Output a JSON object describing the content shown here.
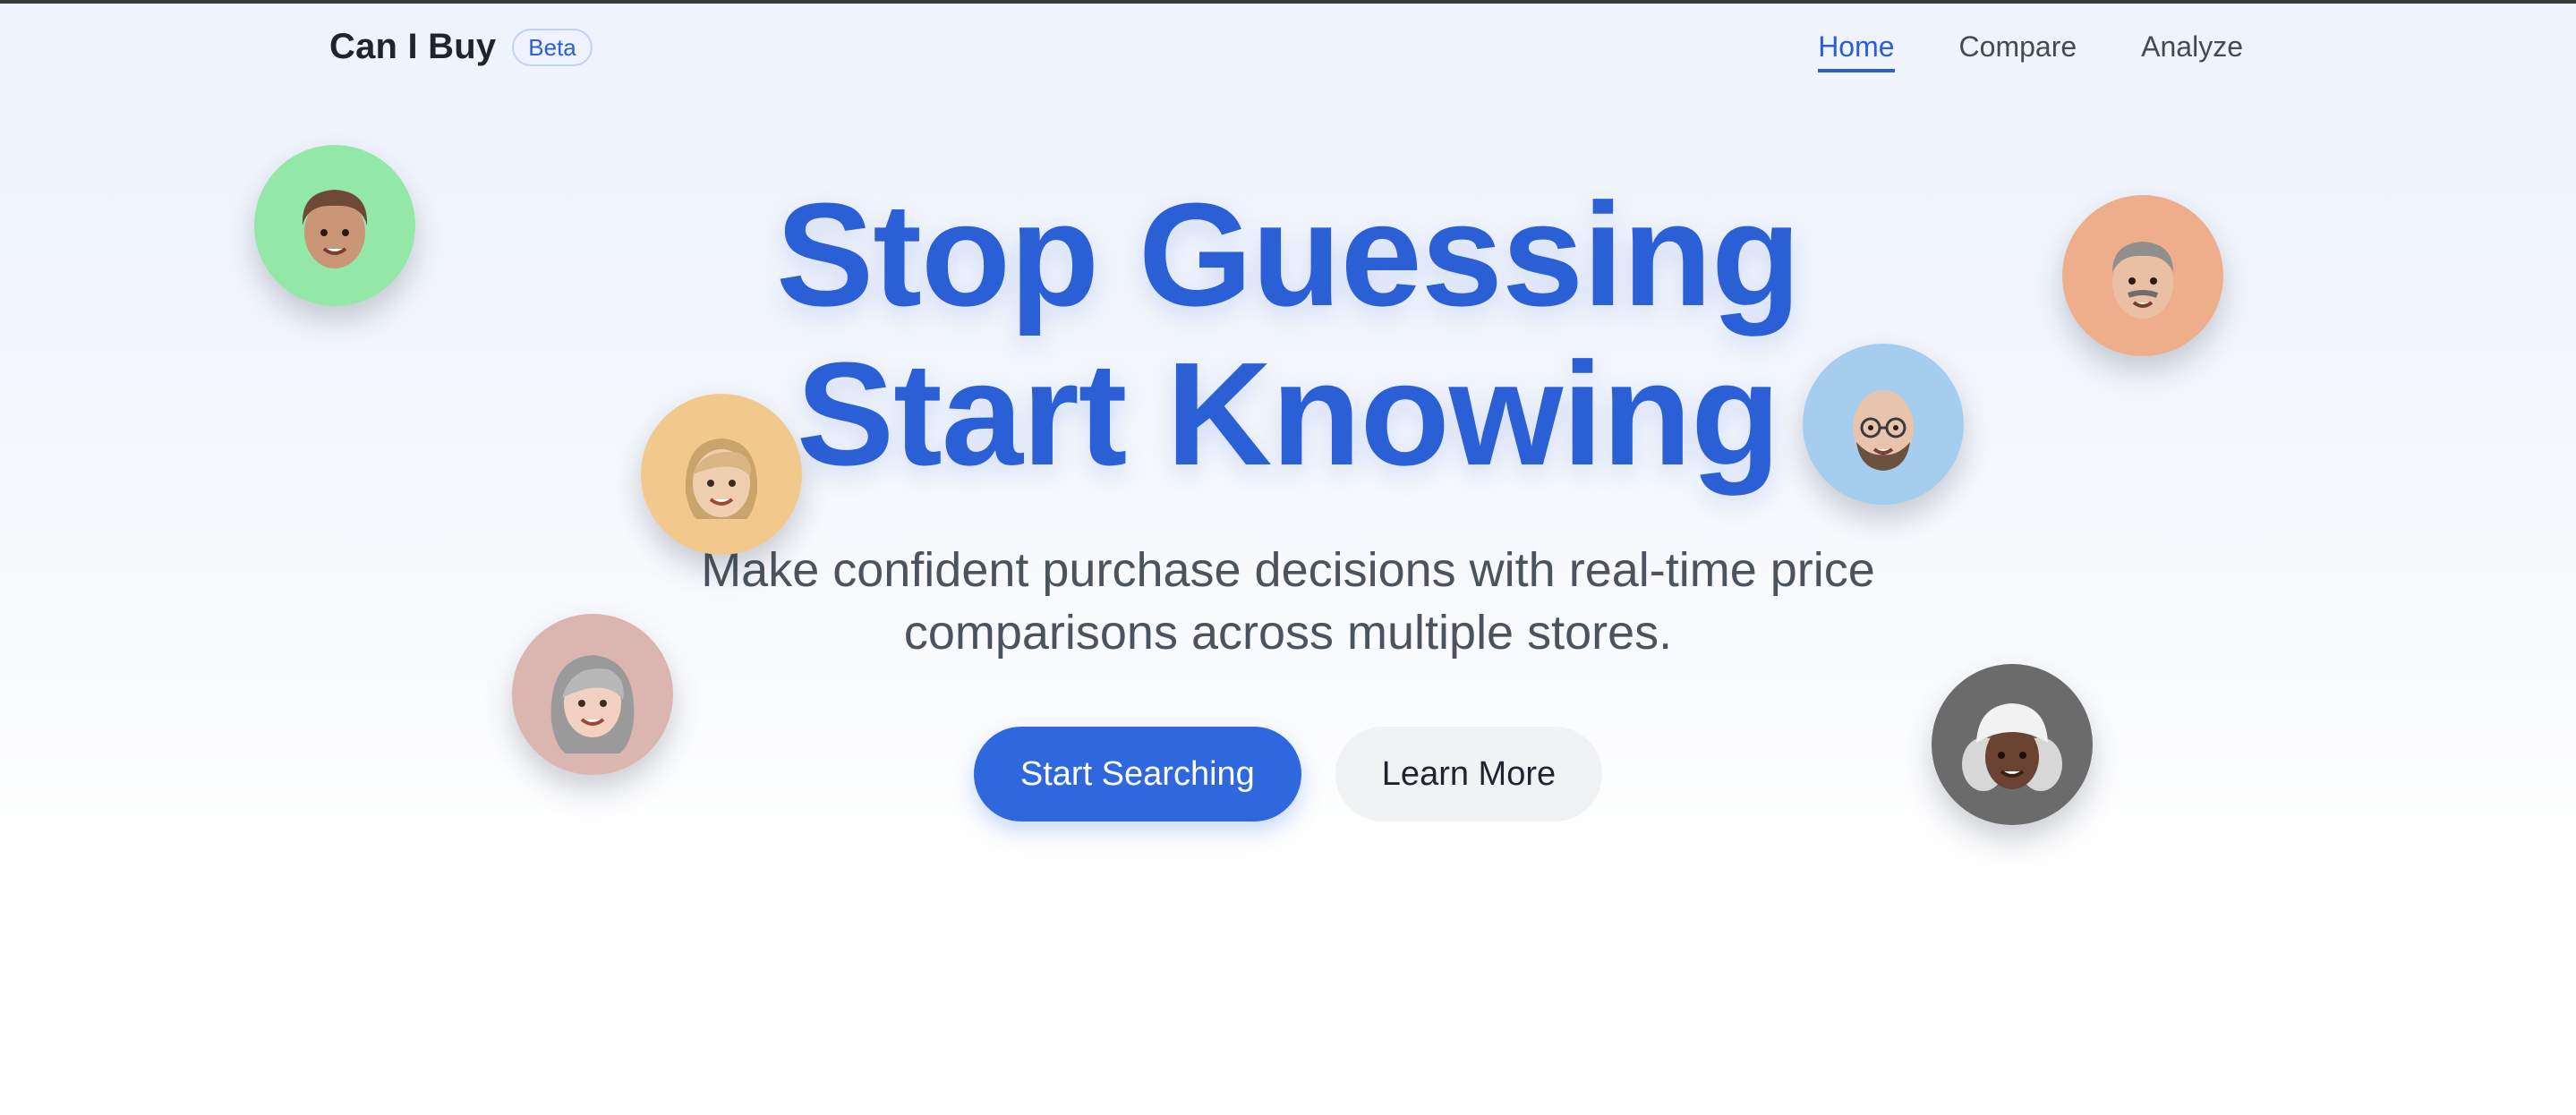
{
  "header": {
    "logo": "Can I Buy",
    "badge": "Beta",
    "nav": [
      {
        "label": "Home",
        "active": true
      },
      {
        "label": "Compare",
        "active": false
      },
      {
        "label": "Analyze",
        "active": false
      }
    ]
  },
  "hero": {
    "title_line1": "Stop Guessing",
    "title_line2": "Start Knowing",
    "subtitle": "Make confident purchase decisions with real-time price comparisons across multiple stores.",
    "primary_button": "Start Searching",
    "secondary_button": "Learn More"
  },
  "avatars": [
    {
      "name": "memoji-boy-bangs",
      "bg": "#93e8a8"
    },
    {
      "name": "memoji-blonde-woman",
      "bg": "#f2c98c"
    },
    {
      "name": "memoji-gray-haired-woman",
      "bg": "#dbb5b0"
    },
    {
      "name": "memoji-older-man",
      "bg": "#eeae8c"
    },
    {
      "name": "memoji-bald-glasses-man",
      "bg": "#a4cdee"
    },
    {
      "name": "memoji-woman-white-hat",
      "bg": "#6b6b6b"
    }
  ],
  "colors": {
    "accent": "#2b5fd6",
    "text_dark": "#1f2430",
    "text_muted": "#4b5360"
  }
}
